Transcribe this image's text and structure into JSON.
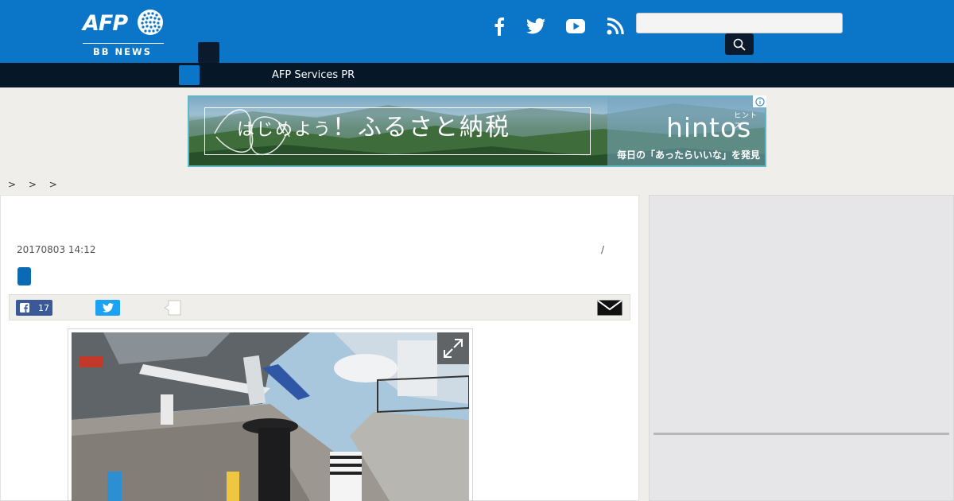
{
  "header": {
    "logo_text": "AFP",
    "logo_subtext": "BB NEWS",
    "social_icons": [
      "facebook-icon",
      "twitter-icon",
      "youtube-icon",
      "rss-icon"
    ],
    "search": {
      "value": "",
      "placeholder": ""
    },
    "colors": {
      "header_bg": "#0b75c7",
      "nav_bg": "#061728"
    }
  },
  "nav": {
    "link_label": "AFP Services PR"
  },
  "ad_banner": {
    "headline_part1": "はじめよう",
    "headline_part2": "！ふるさと納税",
    "brand": "hintos",
    "brand_kana": "ヒントス",
    "tagline": "毎日の「あったらいいな」を発見"
  },
  "breadcrumb": {
    "separators": "> > >"
  },
  "article": {
    "timestamp": "20170803 14:12",
    "divider": "/",
    "share": {
      "facebook_count": "17"
    }
  }
}
